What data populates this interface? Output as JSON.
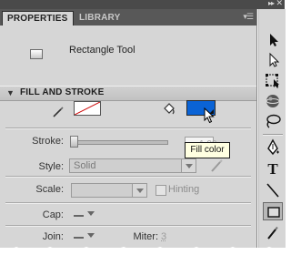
{
  "panel": {
    "tabs": [
      {
        "label": "PROPERTIES",
        "active": true
      },
      {
        "label": "LIBRARY",
        "active": false
      }
    ],
    "menu_icon": "panel-menu-icon"
  },
  "tool": {
    "name": "Rectangle Tool",
    "icon": "rectangle-tool-icon"
  },
  "fill_and_stroke": {
    "title": "FILL AND STROKE",
    "stroke_color": {
      "icon": "pencil-icon",
      "value": "none",
      "swatch_color": "#ffffff"
    },
    "fill_color": {
      "icon": "paint-bucket-icon",
      "value": "#0a63d6"
    },
    "tooltip": "Fill color",
    "stroke": {
      "label": "Stroke:",
      "value": "1.00"
    },
    "style": {
      "label": "Style:",
      "value": "Solid"
    },
    "scale": {
      "label": "Scale:",
      "value": ""
    },
    "hinting": {
      "label": "Hinting",
      "checked": false
    },
    "cap": {
      "label": "Cap:"
    },
    "join": {
      "label": "Join:"
    },
    "miter": {
      "label": "Miter:",
      "value": "3"
    }
  },
  "toolbar": {
    "tools": [
      {
        "name": "selection-tool",
        "icon": "arrow-icon"
      },
      {
        "name": "subselection-tool",
        "icon": "white-arrow-icon"
      },
      {
        "name": "free-transform-tool",
        "icon": "transform-icon"
      },
      {
        "name": "3d-rotation-tool",
        "icon": "sphere-icon"
      },
      {
        "name": "lasso-tool",
        "icon": "lasso-icon"
      },
      {
        "name": "pen-tool",
        "icon": "pen-icon"
      },
      {
        "name": "text-tool",
        "icon": "text-icon",
        "glyph": "T"
      },
      {
        "name": "line-tool",
        "icon": "line-icon"
      },
      {
        "name": "rectangle-tool",
        "icon": "rectangle-icon",
        "selected": true
      },
      {
        "name": "pencil-tool",
        "icon": "pencil-icon"
      }
    ]
  },
  "colors": {
    "fill": "#0a63d6",
    "stroke_none": "#cc0000",
    "panel_bg": "#d6d6d6",
    "tab_bar": "#585858"
  }
}
